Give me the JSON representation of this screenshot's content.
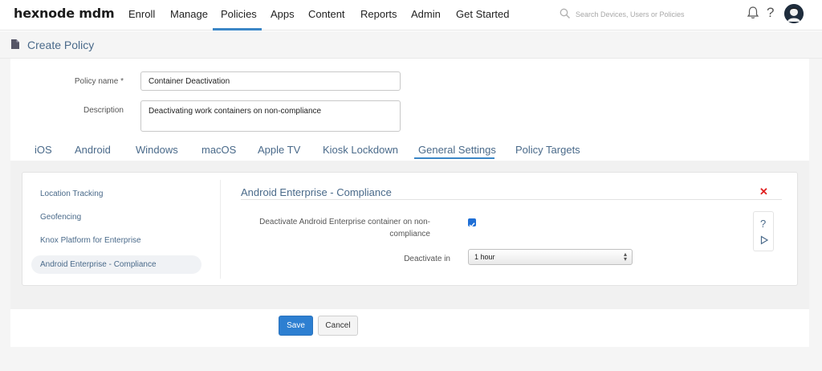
{
  "brand": {
    "logo_text": "hexnode mdm"
  },
  "nav": {
    "items": [
      {
        "label": "Enroll",
        "active": false
      },
      {
        "label": "Manage",
        "active": false
      },
      {
        "label": "Policies",
        "active": true
      },
      {
        "label": "Apps",
        "active": false
      },
      {
        "label": "Content",
        "active": false
      },
      {
        "label": "Reports",
        "active": false
      },
      {
        "label": "Admin",
        "active": false
      },
      {
        "label": "Get Started",
        "active": false
      }
    ],
    "search_placeholder": "Search Devices, Users or Policies",
    "icons": [
      "search-icon",
      "bell-icon",
      "help-icon",
      "avatar"
    ]
  },
  "page": {
    "title": "Create Policy",
    "title_icon": "document-icon"
  },
  "form": {
    "policy_name_label": "Policy name *",
    "policy_name_value": "Container Deactivation",
    "description_label": "Description",
    "description_value": "Deactivating work containers on non-compliance"
  },
  "platform_tabs": [
    {
      "label": "iOS",
      "active": false
    },
    {
      "label": "Android",
      "active": false
    },
    {
      "label": "Windows",
      "active": false
    },
    {
      "label": "macOS",
      "active": false
    },
    {
      "label": "Apple TV",
      "active": false
    },
    {
      "label": "Kiosk Lockdown",
      "active": false
    },
    {
      "label": "General Settings",
      "active": true
    },
    {
      "label": "Policy Targets",
      "active": false
    }
  ],
  "sidebar": {
    "items": [
      {
        "label": "Location Tracking",
        "active": false
      },
      {
        "label": "Geofencing",
        "active": false
      },
      {
        "label": "Knox Platform for Enterprise",
        "active": false
      },
      {
        "label": "Android Enterprise - Compliance",
        "active": true
      }
    ]
  },
  "section": {
    "title": "Android Enterprise - Compliance",
    "close_symbol": "✕",
    "deactivate_label_line1": "Deactivate Android Enterprise container on non-",
    "deactivate_label_line2": "compliance",
    "deactivate_checked": true,
    "deactivate_in_label": "Deactivate in",
    "deactivate_in_value": "1 hour",
    "help_symbol": "?"
  },
  "actions": {
    "save_label": "Save",
    "cancel_label": "Cancel"
  },
  "colors": {
    "accent": "#3b86c6",
    "link": "#4a6a8a",
    "primary_button": "#2d7fd1",
    "danger": "#e02020"
  }
}
